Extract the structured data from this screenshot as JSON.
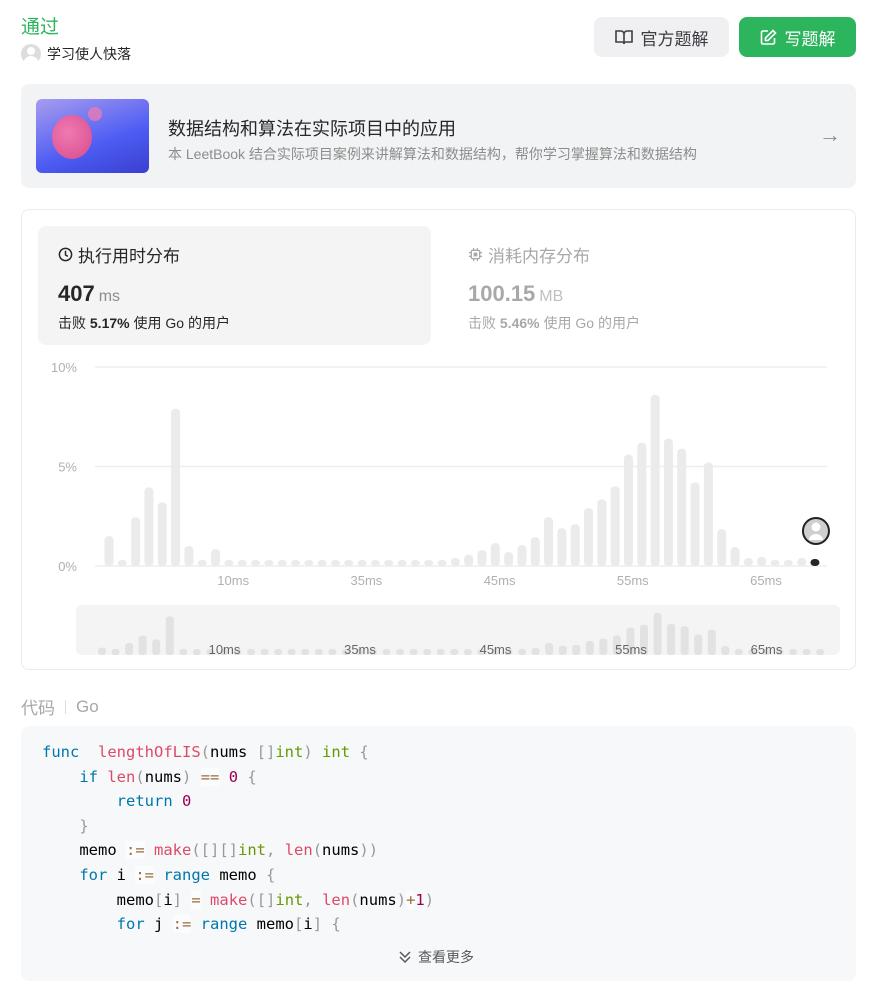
{
  "header": {
    "status": "通过",
    "author": "学习使人快落",
    "official_solution": "官方题解",
    "write_solution": "写题解"
  },
  "colors": {
    "accent": "#2db55d",
    "bar": "#ebebeb",
    "highlight": "#262626"
  },
  "book": {
    "title": "数据结构和算法在实际项目中的应用",
    "desc": "本 LeetBook 结合实际项目案例来讲解算法和数据结构，帮你学习掌握算法和数据结构",
    "icon": "arrow-right-icon"
  },
  "runtime": {
    "title": "执行用时分布",
    "value": "407",
    "unit": "ms",
    "beat_prefix": "击败",
    "beat": "5.17%",
    "beat_suffix": "使用 Go 的用户",
    "icon": "clock-icon"
  },
  "memory": {
    "title": "消耗内存分布",
    "value": "100.15",
    "unit": "MB",
    "beat_prefix": "击败",
    "beat": "5.46%",
    "beat_suffix": "使用 Go 的用户",
    "icon": "chip-icon"
  },
  "chart_data": {
    "type": "bar",
    "y_ticks": [
      "10%",
      "5%",
      "0%"
    ],
    "ylim": [
      0,
      10
    ],
    "grid": true,
    "x_tick_labels": [
      "10ms",
      "35ms",
      "45ms",
      "55ms",
      "65ms"
    ],
    "x_tick_bar_index": [
      10,
      20,
      30,
      40,
      50
    ],
    "values": [
      1.5,
      0.3,
      2.45,
      3.95,
      3.2,
      7.9,
      1.0,
      0.3,
      0.85,
      0.3,
      0.3,
      0.3,
      0.3,
      0.3,
      0.3,
      0.3,
      0.3,
      0.3,
      0.3,
      0.3,
      0.3,
      0.3,
      0.3,
      0.3,
      0.3,
      0.3,
      0.4,
      0.57,
      0.8,
      1.15,
      0.7,
      1.05,
      1.45,
      2.45,
      1.9,
      2.1,
      2.9,
      3.35,
      4.0,
      5.6,
      6.2,
      8.6,
      6.4,
      5.9,
      4.2,
      5.2,
      1.85,
      0.95,
      0.4,
      0.45,
      0.3,
      0.3,
      0.4,
      0.1
    ],
    "highlight_index": 53
  },
  "code": {
    "label": "代码",
    "language": "Go",
    "more": "查看更多",
    "lines": [
      [
        [
          "kw",
          "func"
        ],
        [
          "",
          "  "
        ],
        [
          "fn",
          "lengthOfLIS"
        ],
        [
          "pu",
          "("
        ],
        [
          "",
          "nums "
        ],
        [
          "pu",
          "[]"
        ],
        [
          "ty",
          "int"
        ],
        [
          "pu",
          ")"
        ],
        [
          "",
          " "
        ],
        [
          "ty",
          "int"
        ],
        [
          "",
          " "
        ],
        [
          "pu",
          "{"
        ]
      ],
      [
        [
          "",
          "    "
        ],
        [
          "kw",
          "if"
        ],
        [
          "",
          " "
        ],
        [
          "fn",
          "len"
        ],
        [
          "pu",
          "("
        ],
        [
          "",
          "nums"
        ],
        [
          "pu",
          ")"
        ],
        [
          "",
          " "
        ],
        [
          "op",
          "=="
        ],
        [
          "",
          " "
        ],
        [
          "nu",
          "0"
        ],
        [
          "",
          " "
        ],
        [
          "pu",
          "{"
        ]
      ],
      [
        [
          "",
          "        "
        ],
        [
          "kw",
          "return"
        ],
        [
          "",
          " "
        ],
        [
          "nu",
          "0"
        ]
      ],
      [
        [
          "",
          "    "
        ],
        [
          "pu",
          "}"
        ]
      ],
      [
        [
          "",
          "    memo "
        ],
        [
          "op",
          ":="
        ],
        [
          "",
          " "
        ],
        [
          "fn",
          "make"
        ],
        [
          "pu",
          "([][]"
        ],
        [
          "ty",
          "int"
        ],
        [
          "pu",
          ","
        ],
        [
          "",
          " "
        ],
        [
          "fn",
          "len"
        ],
        [
          "pu",
          "("
        ],
        [
          "",
          "nums"
        ],
        [
          "pu",
          "))"
        ]
      ],
      [
        [
          "",
          "    "
        ],
        [
          "kw",
          "for"
        ],
        [
          "",
          " i "
        ],
        [
          "op",
          ":="
        ],
        [
          "",
          " "
        ],
        [
          "kw",
          "range"
        ],
        [
          "",
          " memo "
        ],
        [
          "pu",
          "{"
        ]
      ],
      [
        [
          "",
          "        memo"
        ],
        [
          "pu",
          "["
        ],
        [
          "",
          "i"
        ],
        [
          "pu",
          "]"
        ],
        [
          "",
          " "
        ],
        [
          "op",
          "="
        ],
        [
          "",
          " "
        ],
        [
          "fn",
          "make"
        ],
        [
          "pu",
          "([]"
        ],
        [
          "ty",
          "int"
        ],
        [
          "pu",
          ","
        ],
        [
          "",
          " "
        ],
        [
          "fn",
          "len"
        ],
        [
          "pu",
          "("
        ],
        [
          "",
          "nums"
        ],
        [
          "pu",
          ")"
        ],
        [
          "op",
          "+"
        ],
        [
          "nu",
          "1"
        ],
        [
          "pu",
          ")"
        ]
      ],
      [
        [
          "",
          "        "
        ],
        [
          "kw",
          "for"
        ],
        [
          "",
          " j "
        ],
        [
          "op",
          ":="
        ],
        [
          "",
          " "
        ],
        [
          "kw",
          "range"
        ],
        [
          "",
          " memo"
        ],
        [
          "pu",
          "["
        ],
        [
          "",
          "i"
        ],
        [
          "pu",
          "]"
        ],
        [
          "",
          " "
        ],
        [
          "pu",
          "{"
        ]
      ]
    ]
  }
}
